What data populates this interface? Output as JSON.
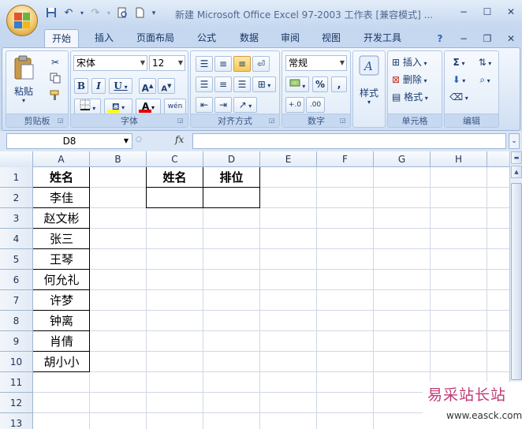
{
  "window": {
    "title": "新建 Microsoft Office Excel 97-2003 工作表 [兼容模式] ...",
    "controls": [
      "−",
      "☐",
      "✕"
    ]
  },
  "qat": [
    "save-icon",
    "undo-icon",
    "redo-icon",
    "print-preview-icon",
    "new-icon"
  ],
  "tabs": [
    {
      "label": "开始",
      "active": true
    },
    {
      "label": "插入"
    },
    {
      "label": "页面布局"
    },
    {
      "label": "公式"
    },
    {
      "label": "数据"
    },
    {
      "label": "审阅"
    },
    {
      "label": "视图"
    },
    {
      "label": "开发工具"
    }
  ],
  "ribbon": {
    "clipboard": {
      "label": "剪贴板",
      "paste": "粘贴"
    },
    "font": {
      "label": "字体",
      "name": "宋体",
      "size": "12",
      "bold": "B",
      "italic": "I",
      "underline": "U",
      "grow": "A",
      "shrink": "A",
      "phonetic": "wén"
    },
    "alignment": {
      "label": "对齐方式"
    },
    "number": {
      "label": "数字",
      "format": "常规",
      "percent": "%",
      "comma": ",",
      "inc_decimal": "+.0",
      "dec_decimal": ".00"
    },
    "styles": {
      "label": "样式"
    },
    "cells": {
      "label": "单元格",
      "insert": "插入",
      "delete": "删除",
      "format": "格式"
    },
    "editing": {
      "label": "编辑",
      "sum": "Σ"
    }
  },
  "formula_bar": {
    "name_box": "D8",
    "fx": "fx",
    "value": ""
  },
  "sheet": {
    "columns": [
      "A",
      "B",
      "C",
      "D",
      "E",
      "F",
      "G",
      "H"
    ],
    "rows": [
      "1",
      "2",
      "3",
      "4",
      "5",
      "6",
      "7",
      "8",
      "9",
      "10",
      "11",
      "12",
      "13"
    ],
    "colA": [
      "姓名",
      "李佳",
      "赵文彬",
      "张三",
      "王琴",
      "何允礼",
      "许梦",
      "钟离",
      "肖倩",
      "胡小小"
    ],
    "c1": "姓名",
    "d1": "排位"
  },
  "watermark": {
    "title": "易采站长站",
    "url": "www.easck.com"
  }
}
